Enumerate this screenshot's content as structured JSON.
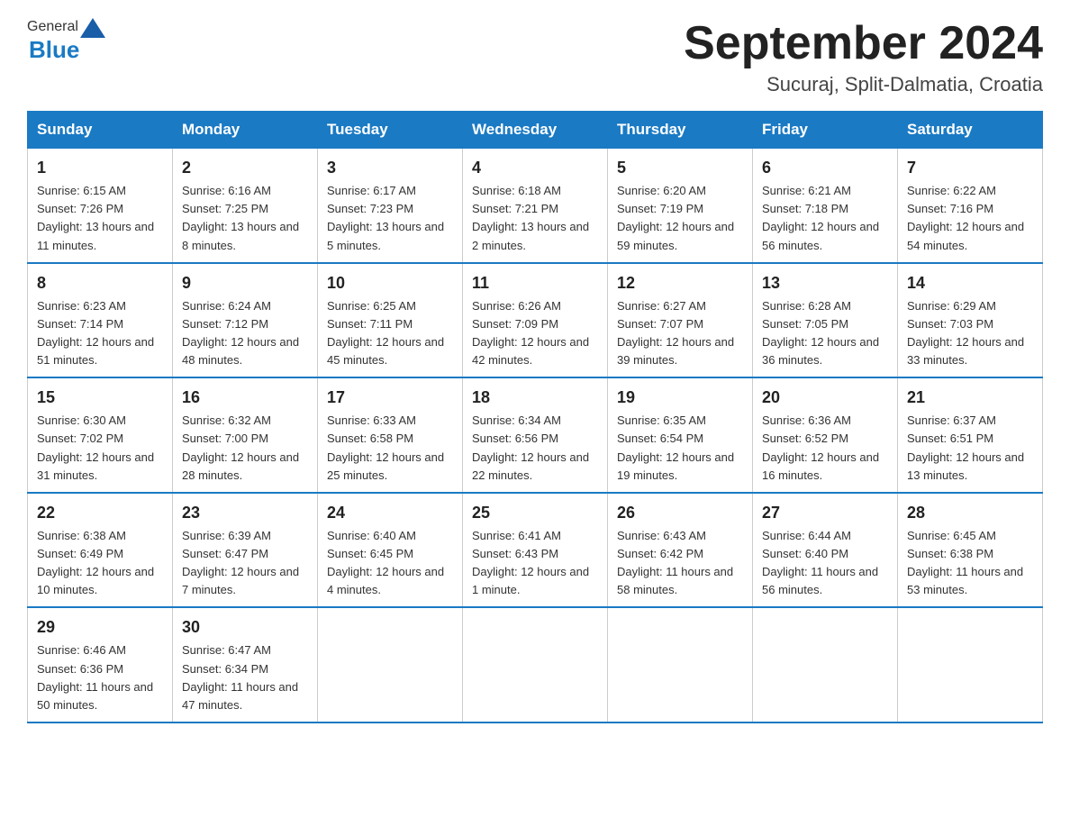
{
  "header": {
    "logo_general": "General",
    "logo_blue": "Blue",
    "month_title": "September 2024",
    "location": "Sucuraj, Split-Dalmatia, Croatia"
  },
  "columns": [
    "Sunday",
    "Monday",
    "Tuesday",
    "Wednesday",
    "Thursday",
    "Friday",
    "Saturday"
  ],
  "weeks": [
    [
      {
        "day": "1",
        "sunrise": "Sunrise: 6:15 AM",
        "sunset": "Sunset: 7:26 PM",
        "daylight": "Daylight: 13 hours and 11 minutes."
      },
      {
        "day": "2",
        "sunrise": "Sunrise: 6:16 AM",
        "sunset": "Sunset: 7:25 PM",
        "daylight": "Daylight: 13 hours and 8 minutes."
      },
      {
        "day": "3",
        "sunrise": "Sunrise: 6:17 AM",
        "sunset": "Sunset: 7:23 PM",
        "daylight": "Daylight: 13 hours and 5 minutes."
      },
      {
        "day": "4",
        "sunrise": "Sunrise: 6:18 AM",
        "sunset": "Sunset: 7:21 PM",
        "daylight": "Daylight: 13 hours and 2 minutes."
      },
      {
        "day": "5",
        "sunrise": "Sunrise: 6:20 AM",
        "sunset": "Sunset: 7:19 PM",
        "daylight": "Daylight: 12 hours and 59 minutes."
      },
      {
        "day": "6",
        "sunrise": "Sunrise: 6:21 AM",
        "sunset": "Sunset: 7:18 PM",
        "daylight": "Daylight: 12 hours and 56 minutes."
      },
      {
        "day": "7",
        "sunrise": "Sunrise: 6:22 AM",
        "sunset": "Sunset: 7:16 PM",
        "daylight": "Daylight: 12 hours and 54 minutes."
      }
    ],
    [
      {
        "day": "8",
        "sunrise": "Sunrise: 6:23 AM",
        "sunset": "Sunset: 7:14 PM",
        "daylight": "Daylight: 12 hours and 51 minutes."
      },
      {
        "day": "9",
        "sunrise": "Sunrise: 6:24 AM",
        "sunset": "Sunset: 7:12 PM",
        "daylight": "Daylight: 12 hours and 48 minutes."
      },
      {
        "day": "10",
        "sunrise": "Sunrise: 6:25 AM",
        "sunset": "Sunset: 7:11 PM",
        "daylight": "Daylight: 12 hours and 45 minutes."
      },
      {
        "day": "11",
        "sunrise": "Sunrise: 6:26 AM",
        "sunset": "Sunset: 7:09 PM",
        "daylight": "Daylight: 12 hours and 42 minutes."
      },
      {
        "day": "12",
        "sunrise": "Sunrise: 6:27 AM",
        "sunset": "Sunset: 7:07 PM",
        "daylight": "Daylight: 12 hours and 39 minutes."
      },
      {
        "day": "13",
        "sunrise": "Sunrise: 6:28 AM",
        "sunset": "Sunset: 7:05 PM",
        "daylight": "Daylight: 12 hours and 36 minutes."
      },
      {
        "day": "14",
        "sunrise": "Sunrise: 6:29 AM",
        "sunset": "Sunset: 7:03 PM",
        "daylight": "Daylight: 12 hours and 33 minutes."
      }
    ],
    [
      {
        "day": "15",
        "sunrise": "Sunrise: 6:30 AM",
        "sunset": "Sunset: 7:02 PM",
        "daylight": "Daylight: 12 hours and 31 minutes."
      },
      {
        "day": "16",
        "sunrise": "Sunrise: 6:32 AM",
        "sunset": "Sunset: 7:00 PM",
        "daylight": "Daylight: 12 hours and 28 minutes."
      },
      {
        "day": "17",
        "sunrise": "Sunrise: 6:33 AM",
        "sunset": "Sunset: 6:58 PM",
        "daylight": "Daylight: 12 hours and 25 minutes."
      },
      {
        "day": "18",
        "sunrise": "Sunrise: 6:34 AM",
        "sunset": "Sunset: 6:56 PM",
        "daylight": "Daylight: 12 hours and 22 minutes."
      },
      {
        "day": "19",
        "sunrise": "Sunrise: 6:35 AM",
        "sunset": "Sunset: 6:54 PM",
        "daylight": "Daylight: 12 hours and 19 minutes."
      },
      {
        "day": "20",
        "sunrise": "Sunrise: 6:36 AM",
        "sunset": "Sunset: 6:52 PM",
        "daylight": "Daylight: 12 hours and 16 minutes."
      },
      {
        "day": "21",
        "sunrise": "Sunrise: 6:37 AM",
        "sunset": "Sunset: 6:51 PM",
        "daylight": "Daylight: 12 hours and 13 minutes."
      }
    ],
    [
      {
        "day": "22",
        "sunrise": "Sunrise: 6:38 AM",
        "sunset": "Sunset: 6:49 PM",
        "daylight": "Daylight: 12 hours and 10 minutes."
      },
      {
        "day": "23",
        "sunrise": "Sunrise: 6:39 AM",
        "sunset": "Sunset: 6:47 PM",
        "daylight": "Daylight: 12 hours and 7 minutes."
      },
      {
        "day": "24",
        "sunrise": "Sunrise: 6:40 AM",
        "sunset": "Sunset: 6:45 PM",
        "daylight": "Daylight: 12 hours and 4 minutes."
      },
      {
        "day": "25",
        "sunrise": "Sunrise: 6:41 AM",
        "sunset": "Sunset: 6:43 PM",
        "daylight": "Daylight: 12 hours and 1 minute."
      },
      {
        "day": "26",
        "sunrise": "Sunrise: 6:43 AM",
        "sunset": "Sunset: 6:42 PM",
        "daylight": "Daylight: 11 hours and 58 minutes."
      },
      {
        "day": "27",
        "sunrise": "Sunrise: 6:44 AM",
        "sunset": "Sunset: 6:40 PM",
        "daylight": "Daylight: 11 hours and 56 minutes."
      },
      {
        "day": "28",
        "sunrise": "Sunrise: 6:45 AM",
        "sunset": "Sunset: 6:38 PM",
        "daylight": "Daylight: 11 hours and 53 minutes."
      }
    ],
    [
      {
        "day": "29",
        "sunrise": "Sunrise: 6:46 AM",
        "sunset": "Sunset: 6:36 PM",
        "daylight": "Daylight: 11 hours and 50 minutes."
      },
      {
        "day": "30",
        "sunrise": "Sunrise: 6:47 AM",
        "sunset": "Sunset: 6:34 PM",
        "daylight": "Daylight: 11 hours and 47 minutes."
      },
      {
        "day": "",
        "sunrise": "",
        "sunset": "",
        "daylight": ""
      },
      {
        "day": "",
        "sunrise": "",
        "sunset": "",
        "daylight": ""
      },
      {
        "day": "",
        "sunrise": "",
        "sunset": "",
        "daylight": ""
      },
      {
        "day": "",
        "sunrise": "",
        "sunset": "",
        "daylight": ""
      },
      {
        "day": "",
        "sunrise": "",
        "sunset": "",
        "daylight": ""
      }
    ]
  ]
}
